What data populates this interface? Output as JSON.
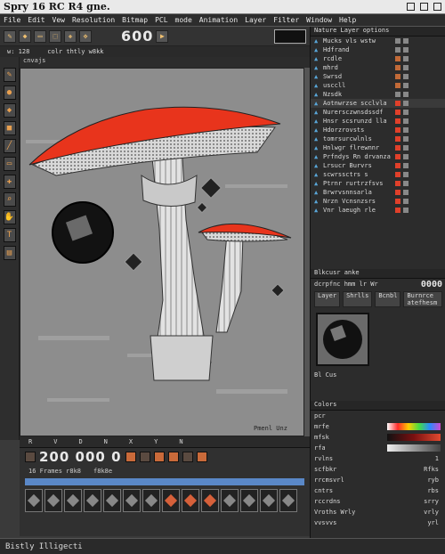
{
  "window": {
    "title": "Spry 16 RC R4 gne."
  },
  "menu": {
    "items": [
      "File",
      "Edit",
      "Vew",
      "Resolution",
      "Bitmap",
      "PCL",
      "mode",
      "Animation",
      "Layer",
      "Filter",
      "Window",
      "Help"
    ]
  },
  "toolbar": {
    "counter": "600",
    "icons": [
      "brush-icon",
      "bucket-icon",
      "eraser-icon",
      "select-icon",
      "dropper-icon",
      "move-icon"
    ]
  },
  "subbar": {
    "left": "w: 128",
    "middle": "colr  thtly  w8kk"
  },
  "canvas": {
    "top_label": "cnvajs",
    "corner_text": "Pmenl  Unz",
    "status": [
      "R",
      "V",
      "D",
      "N",
      "X",
      "Y",
      "N"
    ]
  },
  "timeline": {
    "counter": "200 000 0",
    "frame_label": "16  Frames  r8k8",
    "frame_count_label": "f8k8e",
    "frames": 14,
    "selected_frames": [
      7,
      8,
      9
    ]
  },
  "status": {
    "text": "Bistly Illigecti"
  },
  "layers": {
    "header": "Nature  Layer  options",
    "items": [
      {
        "name": "Mucks  vls  wstw",
        "swatch": "gry"
      },
      {
        "name": "Hdfrand",
        "swatch": "gry"
      },
      {
        "name": "rcdle",
        "swatch": "org"
      },
      {
        "name": "mhrd",
        "swatch": "org"
      },
      {
        "name": "Swrsd",
        "swatch": "org"
      },
      {
        "name": "usccll",
        "swatch": "org"
      },
      {
        "name": "Nzsdk",
        "swatch": "gry"
      },
      {
        "name": "Aotnwrzse  scclvla",
        "swatch": "red"
      },
      {
        "name": "Nurersczwnsdssdf",
        "swatch": "red"
      },
      {
        "name": "Hnsr scsrunzd  lla",
        "swatch": "red"
      },
      {
        "name": "Hdorzrovsts",
        "swatch": "red"
      },
      {
        "name": "tomrsurcwlnls",
        "swatch": "red"
      },
      {
        "name": "Hnlwgr flrewnnr",
        "swatch": "red"
      },
      {
        "name": "Prfndys  Rn  drvanza",
        "swatch": "red"
      },
      {
        "name": "Lrsucr  Burvrs",
        "swatch": "red"
      },
      {
        "name": "scwrssctrs  s",
        "swatch": "red"
      },
      {
        "name": "Ptrnr  rurtrzfsvs",
        "swatch": "red"
      },
      {
        "name": "Brwrvsnnsarla",
        "swatch": "red"
      },
      {
        "name": "Nrzn  Vcnsnzsrs",
        "swatch": "red"
      },
      {
        "name": "Vnr  laeugh  rle",
        "swatch": "red"
      }
    ]
  },
  "properties": {
    "header": "Blkcusr  anke",
    "row1_label": "dcrpfnc  hmm  lr  Wr",
    "row1_value": "0000",
    "tabs": [
      "Layer",
      "Shrlls",
      "Bcnbl",
      "Burnrce  atefhesm"
    ],
    "preview_label": "Bl  Cus"
  },
  "colors": {
    "header": "Colors",
    "rows": [
      {
        "label": "pcr",
        "grad": "none"
      },
      {
        "label": "mrfe",
        "grad": "rainbow"
      },
      {
        "label": "mfsk",
        "grad": "dark"
      },
      {
        "label": "rfa",
        "grad": "gray"
      }
    ],
    "settings": [
      {
        "label": "rvlns",
        "value": "1"
      },
      {
        "label": "scfbkr",
        "value": "Rfks"
      },
      {
        "label": "rrcmsvrl",
        "value": "ryb"
      },
      {
        "label": "cntrs",
        "value": "rbs"
      },
      {
        "label": "rccrdns",
        "value": "srry"
      },
      {
        "label": "Vroths  Wrly",
        "value": "vrly"
      },
      {
        "label": "vvsvvs",
        "value": "yrl"
      }
    ]
  },
  "accent": {
    "cap_red": "#e8341c",
    "canvas_gray": "#8d8d8d"
  }
}
